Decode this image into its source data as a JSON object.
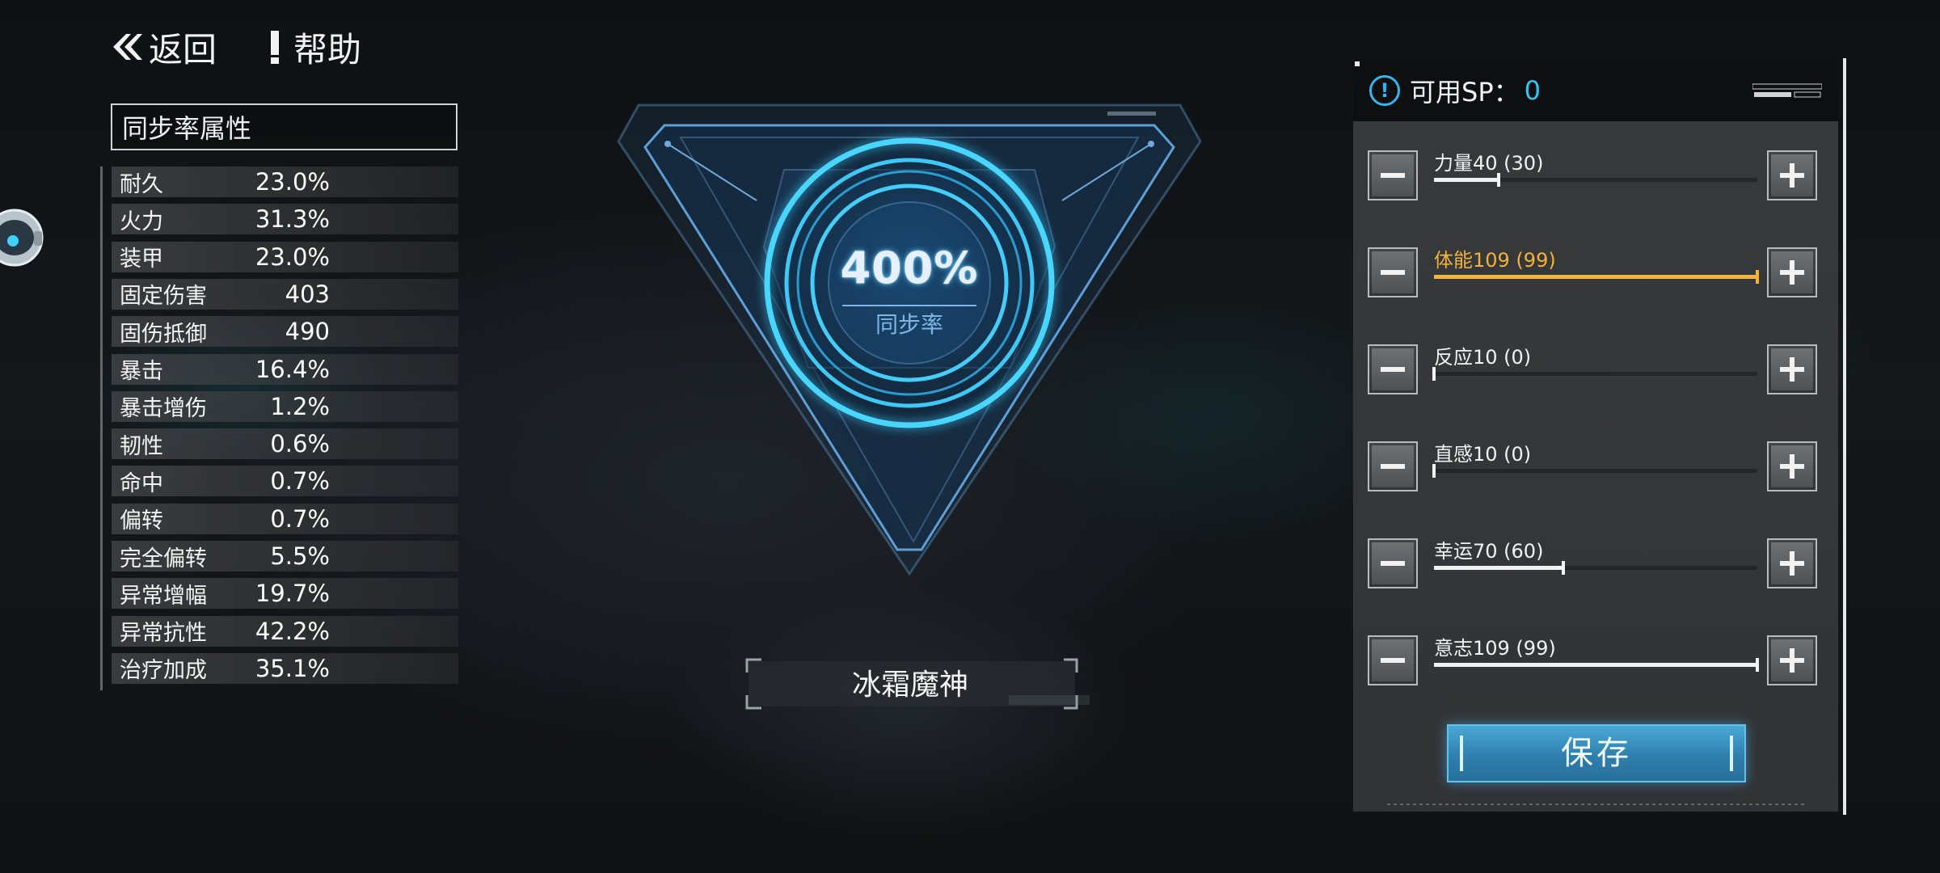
{
  "nav": {
    "back_label": "返回",
    "help_label": "帮助"
  },
  "attributes": {
    "title": "同步率属性",
    "rows": [
      {
        "name": "耐久",
        "value": "23.0%"
      },
      {
        "name": "火力",
        "value": "31.3%"
      },
      {
        "name": "装甲",
        "value": "23.0%"
      },
      {
        "name": "固定伤害",
        "value": "403"
      },
      {
        "name": "固伤抵御",
        "value": "490"
      },
      {
        "name": "暴击",
        "value": "16.4%"
      },
      {
        "name": "暴击增伤",
        "value": "1.2%"
      },
      {
        "name": "韧性",
        "value": "0.6%"
      },
      {
        "name": "命中",
        "value": "0.7%"
      },
      {
        "name": "偏转",
        "value": "0.7%"
      },
      {
        "name": "完全偏转",
        "value": "5.5%"
      },
      {
        "name": "异常增幅",
        "value": "19.7%"
      },
      {
        "name": "异常抗性",
        "value": "42.2%"
      },
      {
        "name": "治疗加成",
        "value": "35.1%"
      }
    ]
  },
  "sync": {
    "value": "400%",
    "label": "同步率",
    "name": "冰霜魔神"
  },
  "sp": {
    "label": "可用SP：",
    "value": "0",
    "stats": [
      {
        "label": "力量40  (30)",
        "fill": 0.2,
        "highlight": false
      },
      {
        "label": "体能109  (99)",
        "fill": 1.0,
        "highlight": true
      },
      {
        "label": "反应10  (0)",
        "fill": 0.0,
        "highlight": false
      },
      {
        "label": "直感10  (0)",
        "fill": 0.0,
        "highlight": false
      },
      {
        "label": "幸运70  (60)",
        "fill": 0.4,
        "highlight": false
      },
      {
        "label": "意志109  (99)",
        "fill": 1.0,
        "highlight": false
      }
    ],
    "save_label": "保存"
  },
  "colors": {
    "accent_blue": "#37c3f0",
    "highlight_orange": "#f3b23a",
    "glow_cyan": "#3fd0ff"
  }
}
